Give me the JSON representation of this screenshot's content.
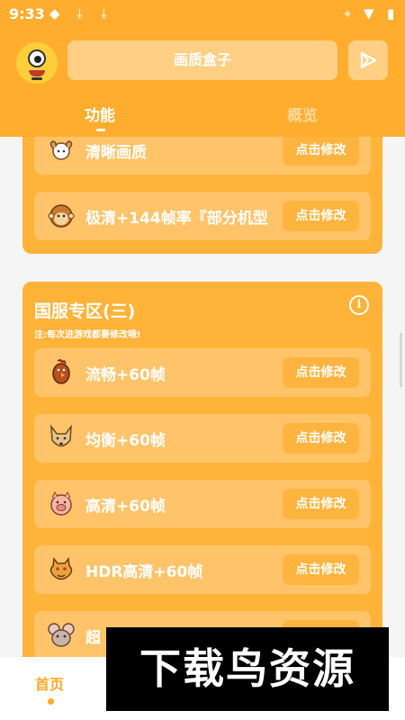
{
  "status_bar": {
    "time": "9:33"
  },
  "header": {
    "title": "画质盒子"
  },
  "tabs": [
    {
      "label": "功能",
      "active": true
    },
    {
      "label": "概览",
      "active": false
    }
  ],
  "card1": {
    "rows": [
      {
        "label": "清晰画质",
        "button": "点击修改",
        "icon": "ram-icon"
      },
      {
        "label": "极清+144帧率『部分机型",
        "button": "点击修改",
        "icon": "monkey-icon"
      }
    ]
  },
  "card2": {
    "title": "国服专区(三)",
    "note": "注:每次进游戏都要修改哦!",
    "rows": [
      {
        "label": "流畅+60帧",
        "button": "点击修改",
        "icon": "rooster-icon"
      },
      {
        "label": "均衡+60帧",
        "button": "点击修改",
        "icon": "dog-icon"
      },
      {
        "label": "高清+60帧",
        "button": "点击修改",
        "icon": "pig-icon"
      },
      {
        "label": "HDR高清+60帧",
        "button": "点击修改",
        "icon": "dragon-icon"
      },
      {
        "label": "超",
        "button": "点击修改",
        "icon": "rat-icon"
      }
    ]
  },
  "bottom_nav": {
    "home_label": "首页"
  },
  "watermark": {
    "text": "下载鸟资源"
  },
  "colors": {
    "primary": "#ffad2e",
    "card": "#ffb338",
    "row": "#ffc46a"
  }
}
